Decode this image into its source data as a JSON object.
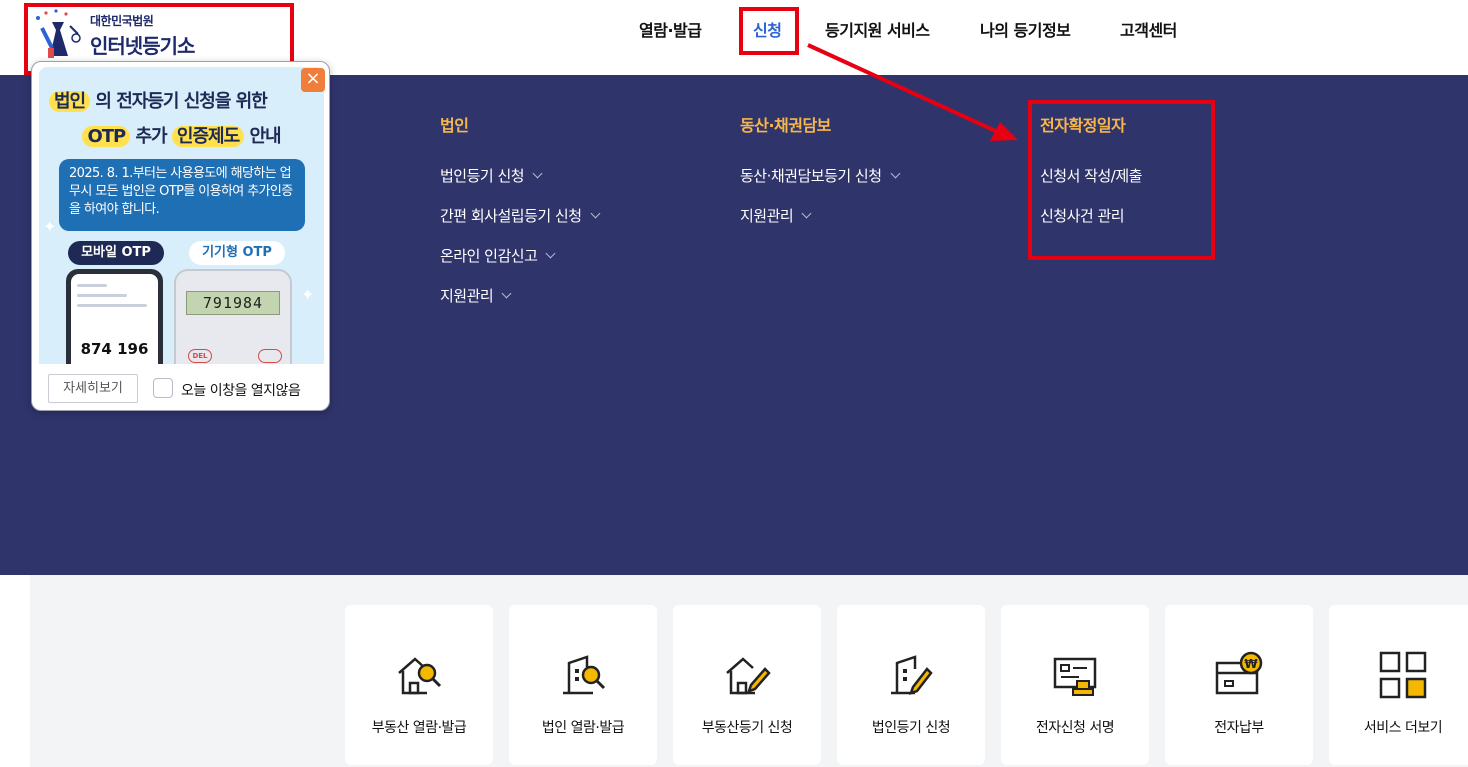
{
  "logo": {
    "small": "대한민국법원",
    "big": "인터넷등기소"
  },
  "nav": {
    "items": [
      {
        "label": "열람·발급"
      },
      {
        "label": "신청"
      },
      {
        "label": "등기지원 서비스"
      },
      {
        "label": "나의 등기정보"
      },
      {
        "label": "고객센터"
      }
    ],
    "active": "신청"
  },
  "menu": {
    "columns": [
      {
        "heading": "법인",
        "links": [
          "법인등기 신청",
          "간편 회사설립등기 신청",
          "온라인 인감신고",
          "지원관리"
        ]
      },
      {
        "heading": "동산·채권담보",
        "links": [
          "동산·채권담보등기 신청",
          "지원관리"
        ]
      },
      {
        "heading": "전자확정일자",
        "links": [
          "신청서 작성/제출",
          "신청사건 관리"
        ]
      }
    ]
  },
  "popup": {
    "line1_hl": "법인",
    "line1_rest": "의 전자등기 신청을 위한",
    "line2_hl1": "OTP",
    "line2_mid": "추가",
    "line2_hl2": "인증제도",
    "line2_end": "안내",
    "notice": "2025. 8. 1.부터는 사용용도에 해당하는 업무시 모든 법인은 OTP를 이용하여 추가인증을 하여야 합니다.",
    "tag_mobile": "모바일 OTP",
    "tag_device": "기기형 OTP",
    "mobile_number": "874 196",
    "device_number": "791984",
    "device_del": "DEL",
    "detail_button": "자세히보기",
    "checkbox_label": "오늘 이창을 열지않음",
    "close_glyph": "×"
  },
  "services": [
    {
      "label": "부동산 열람·발급",
      "icon": "house-search-icon"
    },
    {
      "label": "법인 열람·발급",
      "icon": "building-search-icon"
    },
    {
      "label": "부동산등기 신청",
      "icon": "house-pen-icon"
    },
    {
      "label": "법인등기 신청",
      "icon": "building-pen-icon"
    },
    {
      "label": "전자신청 서명",
      "icon": "signature-icon"
    },
    {
      "label": "전자납부",
      "icon": "won-payment-icon"
    },
    {
      "label": "서비스 더보기",
      "icon": "grid-more-icon"
    }
  ],
  "colors": {
    "menu_bg": "#2f346b",
    "menu_heading": "#f7b64b",
    "active_nav": "#2c64d6",
    "highlight_box": "#e60012",
    "accent_yellow": "#f5b800"
  }
}
